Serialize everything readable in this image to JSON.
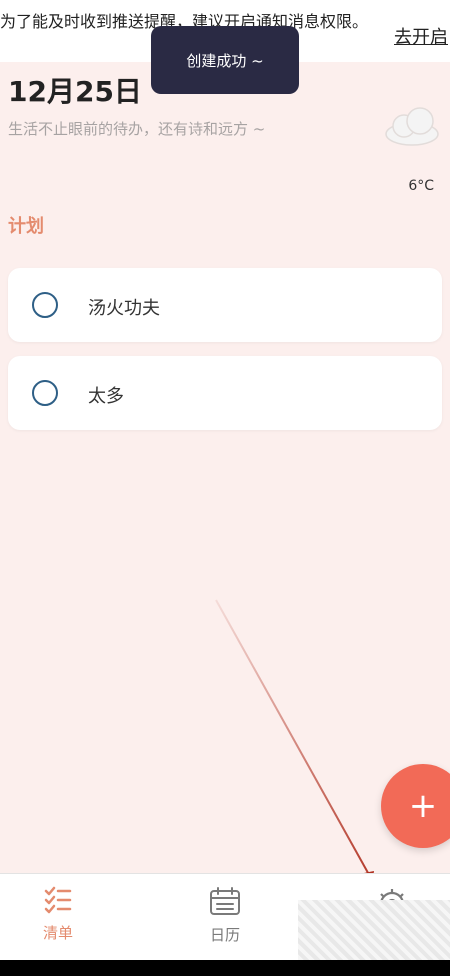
{
  "notification": {
    "message": "为了能及时收到推送提醒，建议开启通知消息权限。",
    "action_label": "去开启"
  },
  "toast": {
    "text": "创建成功 ~"
  },
  "header": {
    "date": "12月25日",
    "motto": "生活不止眼前的待办，还有诗和远方 ~",
    "weather_icon": "cloud-icon",
    "temperature": "6°C"
  },
  "section": {
    "title": "计划"
  },
  "tasks": [
    {
      "label": "汤火功夫",
      "done": false
    },
    {
      "label": "太多",
      "done": false
    }
  ],
  "fab": {
    "icon": "plus-icon",
    "symbol": "+"
  },
  "tabs": [
    {
      "label": "清单",
      "icon": "checklist-icon",
      "active": true
    },
    {
      "label": "日历",
      "icon": "calendar-icon",
      "active": false
    },
    {
      "label": "",
      "icon": "gear-icon",
      "active": false
    }
  ],
  "colors": {
    "background": "#fcefed",
    "accent": "#e48b6e",
    "fab": "#f26a57",
    "checkbox": "#2e5f86",
    "toast": "#2a2a44",
    "annotation_arrow": "#b03020"
  }
}
